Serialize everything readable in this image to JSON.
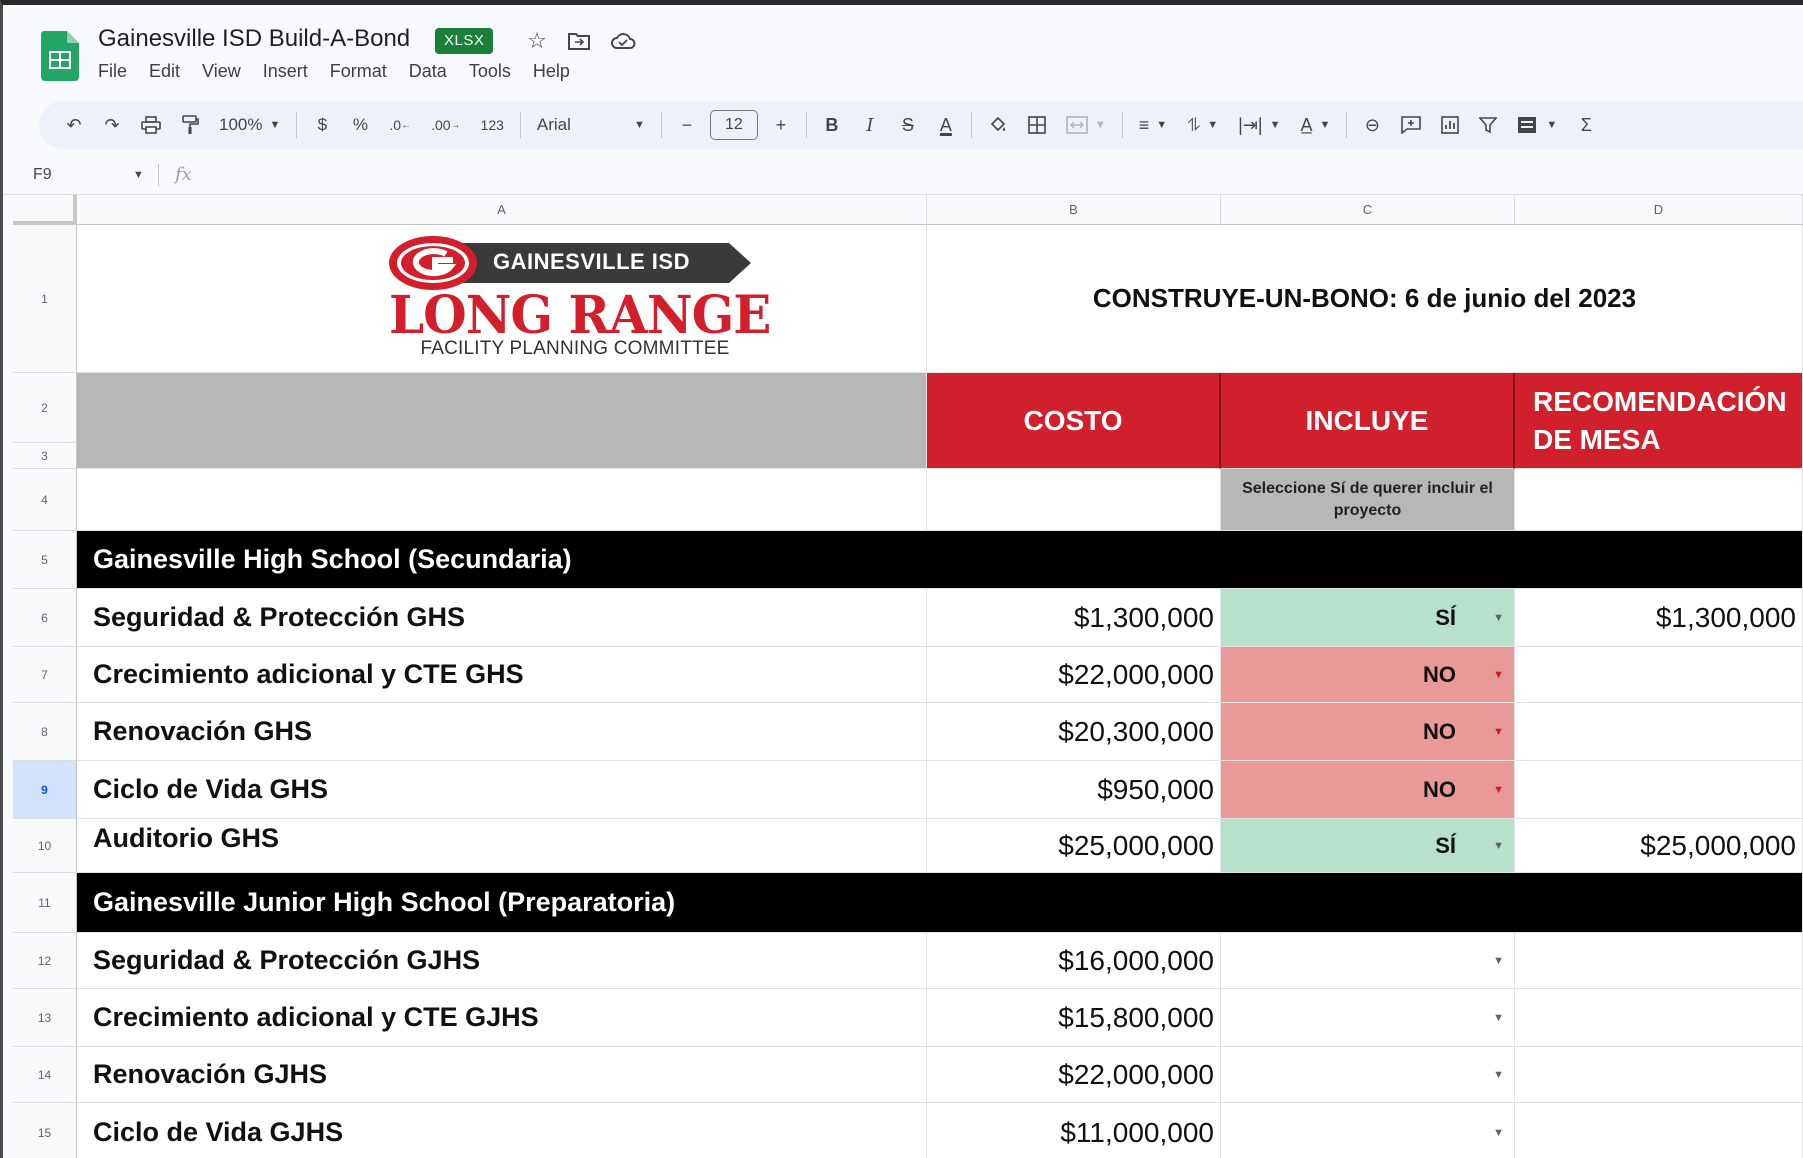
{
  "window": {
    "doc_title": "Gainesville ISD Build-A-Bond",
    "file_badge": "XLSX"
  },
  "menu": [
    "File",
    "Edit",
    "View",
    "Insert",
    "Format",
    "Data",
    "Tools",
    "Help"
  ],
  "toolbar": {
    "zoom": "100%",
    "currency": "$",
    "percent": "%",
    "decrease_decimal": ".0",
    "increase_decimal": ".00",
    "number_format": "123",
    "font": "Arial",
    "font_size": "12",
    "minus": "−",
    "plus": "+",
    "bold": "B",
    "italic": "I",
    "text_color": "A",
    "sum": "Σ"
  },
  "formula_bar": {
    "cell_ref": "F9",
    "fx": "fx",
    "value": ""
  },
  "columns": [
    "A",
    "B",
    "C",
    "D"
  ],
  "rows": [
    "1",
    "2",
    "3",
    "4",
    "5",
    "6",
    "7",
    "8",
    "9",
    "10",
    "11",
    "12",
    "13",
    "14",
    "15"
  ],
  "selected_row": "9",
  "logo": {
    "banner": "GAINESVILLE ISD",
    "title": "LONG RANGE",
    "subtitle": "FACILITY PLANNING COMMITTEE"
  },
  "sheet": {
    "event_title": "CONSTRUYE-UN-BONO: 6 de junio del 2023",
    "headers": {
      "cost": "COSTO",
      "include": "INCLUYE",
      "recommendation_line1": "RECOMENDACIÓN",
      "recommendation_line2": "DE MESA"
    },
    "include_note": "Seleccione Sí de querer incluir el proyecto",
    "sections": [
      {
        "title": "Gainesville High School (Secundaria)",
        "items": [
          {
            "name": "Seguridad & Protección GHS",
            "cost": "$1,300,000",
            "include": "SÍ",
            "recommendation": "$1,300,000"
          },
          {
            "name": "Crecimiento adicional y CTE GHS",
            "cost": "$22,000,000",
            "include": "NO",
            "recommendation": ""
          },
          {
            "name": "Renovación GHS",
            "cost": "$20,300,000",
            "include": "NO",
            "recommendation": ""
          },
          {
            "name": "Ciclo de Vida GHS",
            "cost": "$950,000",
            "include": "NO",
            "recommendation": ""
          },
          {
            "name": "Auditorio GHS",
            "cost": "$25,000,000",
            "include": "SÍ",
            "recommendation": "$25,000,000"
          }
        ]
      },
      {
        "title": "Gainesville Junior High School (Preparatoria)",
        "items": [
          {
            "name": "Seguridad & Protección GJHS",
            "cost": "$16,000,000",
            "include": "",
            "recommendation": ""
          },
          {
            "name": "Crecimiento adicional y CTE GJHS",
            "cost": "$15,800,000",
            "include": "",
            "recommendation": ""
          },
          {
            "name": "Renovación GJHS",
            "cost": "$22,000,000",
            "include": "",
            "recommendation": ""
          },
          {
            "name": "Ciclo de Vida GJHS",
            "cost": "$11,000,000",
            "include": "",
            "recommendation": ""
          }
        ]
      }
    ]
  },
  "colors": {
    "header_red": "#d0202b",
    "yes_green": "#b7e1cd",
    "no_red": "#ea9999",
    "section_black": "#000000",
    "badge_green": "#188038"
  },
  "icons": [
    "sheets-logo-icon",
    "star-icon",
    "folder-move-icon",
    "cloud-status-icon",
    "undo-icon",
    "redo-icon",
    "print-icon",
    "paint-format-icon",
    "fill-color-icon",
    "borders-icon",
    "merge-cells-icon",
    "align-icon",
    "valign-icon",
    "wrap-icon",
    "rotate-icon",
    "link-icon",
    "comment-icon",
    "chart-icon",
    "filter-icon",
    "filter-views-icon",
    "dropdown-arrow-icon"
  ]
}
